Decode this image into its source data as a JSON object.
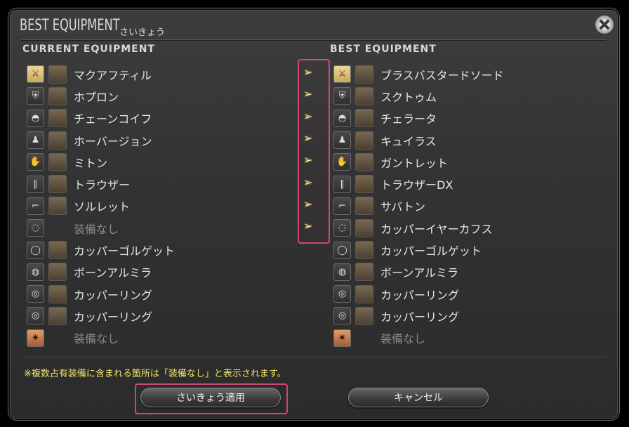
{
  "window": {
    "title": "BEST EQUIPMENT",
    "subtitle": "さいきょう"
  },
  "columns": {
    "current_header": "CURRENT EQUIPMENT",
    "best_header": "BEST EQUIPMENT"
  },
  "rows": [
    {
      "slot": "weapon",
      "current": "マクアフティル",
      "best": "ブラスバスタードソード",
      "changed": true
    },
    {
      "slot": "shield",
      "current": "ホプロン",
      "best": "スクトゥム",
      "changed": true
    },
    {
      "slot": "head",
      "current": "チェーンコイフ",
      "best": "チェラータ",
      "changed": true
    },
    {
      "slot": "body",
      "current": "ホーバージョン",
      "best": "キュイラス",
      "changed": true
    },
    {
      "slot": "hands",
      "current": "ミトン",
      "best": "ガントレット",
      "changed": true
    },
    {
      "slot": "legs",
      "current": "トラウザー",
      "best": "トラウザーDX",
      "changed": true
    },
    {
      "slot": "feet",
      "current": "ソルレット",
      "best": "サバトン",
      "changed": true
    },
    {
      "slot": "earrings",
      "current": "装備なし",
      "best": "カッパーイヤーカフス",
      "changed": true,
      "current_empty": true
    },
    {
      "slot": "necklace",
      "current": "カッパーゴルゲット",
      "best": "カッパーゴルゲット",
      "changed": false
    },
    {
      "slot": "bracelets",
      "current": "ボーンアルミラ",
      "best": "ボーンアルミラ",
      "changed": false
    },
    {
      "slot": "ring",
      "current": "カッパーリング",
      "best": "カッパーリング",
      "changed": false
    },
    {
      "slot": "ring",
      "current": "カッパーリング",
      "best": "カッパーリング",
      "changed": false
    },
    {
      "slot": "soul",
      "current": "装備なし",
      "best": "装備なし",
      "changed": false,
      "current_empty": true,
      "best_empty": true
    }
  ],
  "note": "※複数占有装備に含まれる箇所は「装備なし」と表示されます。",
  "buttons": {
    "apply": "さいきょう適用",
    "cancel": "キャンセル"
  },
  "icons": {
    "close": "close-icon",
    "arrow": "double-arrow-right-icon"
  },
  "colors": {
    "highlight": "#d4447a",
    "note_text": "#f2e36a",
    "arrow": "#f2e7a0"
  }
}
